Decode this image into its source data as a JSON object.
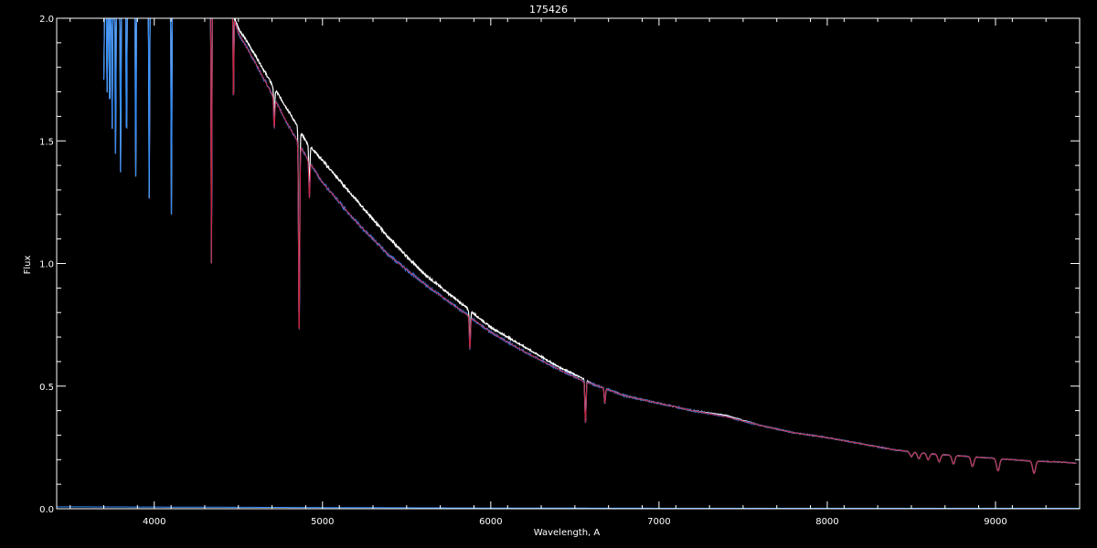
{
  "chart_data": {
    "type": "line",
    "title": "175426",
    "xlabel": "Wavelength, A",
    "ylabel": "Flux",
    "xlim": [
      3420,
      9500
    ],
    "ylim": [
      0.0,
      2.0
    ],
    "x_ticks": [
      4000,
      5000,
      6000,
      7000,
      8000,
      9000
    ],
    "y_ticks": [
      0.0,
      0.5,
      1.0,
      1.5,
      2.0
    ],
    "x_tick_labels": [
      "4000",
      "5000",
      "6000",
      "7000",
      "8000",
      "9000"
    ],
    "y_tick_labels": [
      "0.0",
      "0.5",
      "1.0",
      "1.5",
      "2.0"
    ],
    "grid": false,
    "colors": {
      "background": "#000000",
      "axes": "#ffffff",
      "observed": "#ffffff",
      "flux": "#2f8cff",
      "model": "#d0213a",
      "error": "#2f8cff"
    },
    "series": [
      {
        "key": "observed",
        "x": [
          3700,
          4000,
          4300,
          4450,
          4500,
          4600,
          4700,
          4800,
          4900,
          5000,
          5200,
          5400,
          5600,
          5800,
          6000,
          6200,
          6400,
          6550,
          6600,
          6800,
          7000,
          7200,
          7400,
          7600,
          7800,
          8000,
          8200,
          8400,
          8600,
          8800,
          9000,
          9200,
          9400,
          9480
        ],
        "y": [
          2.05,
          2.05,
          2.05,
          2.05,
          1.96,
          1.85,
          1.73,
          1.62,
          1.5,
          1.42,
          1.26,
          1.1,
          0.96,
          0.85,
          0.74,
          0.66,
          0.58,
          0.53,
          0.51,
          0.46,
          0.43,
          0.4,
          0.38,
          0.34,
          0.31,
          0.29,
          0.265,
          0.24,
          0.225,
          0.215,
          0.205,
          0.195,
          0.19,
          0.185
        ]
      },
      {
        "key": "flux",
        "x": [
          3700,
          4000,
          4300,
          4450,
          4500,
          4600,
          4700,
          4800,
          4900,
          5000,
          5200,
          5400,
          5600,
          5800,
          6000,
          6200,
          6400,
          6550,
          6600,
          6800,
          7000,
          7200,
          7400,
          7600,
          7800,
          8000,
          8200,
          8400,
          8600,
          8800,
          9000,
          9200,
          9400,
          9480
        ],
        "y": [
          2.05,
          2.05,
          2.05,
          2.05,
          1.94,
          1.82,
          1.69,
          1.56,
          1.44,
          1.33,
          1.17,
          1.03,
          0.92,
          0.82,
          0.72,
          0.64,
          0.57,
          0.52,
          0.51,
          0.46,
          0.43,
          0.4,
          0.375,
          0.34,
          0.31,
          0.29,
          0.265,
          0.24,
          0.225,
          0.215,
          0.205,
          0.195,
          0.19,
          0.185
        ]
      },
      {
        "key": "model",
        "x": [
          4300,
          4450,
          4500,
          4600,
          4700,
          4800,
          4900,
          5000,
          5200,
          5400,
          5600,
          5800,
          6000,
          6200,
          6400,
          6550,
          6600,
          6800,
          7000,
          7200,
          7400,
          7600,
          7800,
          8000,
          8200,
          8400,
          8600,
          8800,
          9000,
          9200,
          9400,
          9480
        ],
        "y": [
          2.05,
          2.05,
          1.94,
          1.82,
          1.69,
          1.56,
          1.44,
          1.33,
          1.17,
          1.03,
          0.92,
          0.82,
          0.72,
          0.64,
          0.57,
          0.52,
          0.51,
          0.46,
          0.43,
          0.4,
          0.375,
          0.34,
          0.31,
          0.29,
          0.265,
          0.24,
          0.225,
          0.215,
          0.205,
          0.195,
          0.19,
          0.185
        ]
      },
      {
        "key": "error",
        "x": [
          3420,
          4000,
          5000,
          6000,
          7000,
          8000,
          9000,
          9500
        ],
        "y": [
          0.008,
          0.007,
          0.005,
          0.003,
          0.002,
          0.002,
          0.002,
          0.002
        ]
      }
    ],
    "absorption_lines": [
      {
        "x": 3700,
        "depth": 0.3
      },
      {
        "x": 3720,
        "depth": 0.35
      },
      {
        "x": 3735,
        "depth": 0.42
      },
      {
        "x": 3750,
        "depth": 0.5
      },
      {
        "x": 3770,
        "depth": 0.6
      },
      {
        "x": 3800,
        "depth": 0.68
      },
      {
        "x": 3835,
        "depth": 0.55
      },
      {
        "x": 3890,
        "depth": 0.7
      },
      {
        "x": 3970,
        "depth": 0.78
      },
      {
        "x": 4102,
        "depth": 0.85
      },
      {
        "x": 4340,
        "depth": 1.05
      },
      {
        "x": 4471,
        "depth": 0.35
      },
      {
        "x": 4713,
        "depth": 0.12
      },
      {
        "x": 4861,
        "depth": 0.78
      },
      {
        "x": 4922,
        "depth": 0.15
      },
      {
        "x": 5876,
        "depth": 0.13
      },
      {
        "x": 6563,
        "depth": 0.17
      },
      {
        "x": 6678,
        "depth": 0.06
      },
      {
        "x": 8500,
        "depth": 0.02
      },
      {
        "x": 8545,
        "depth": 0.025
      },
      {
        "x": 8600,
        "depth": 0.025
      },
      {
        "x": 8665,
        "depth": 0.03
      },
      {
        "x": 8750,
        "depth": 0.035
      },
      {
        "x": 8863,
        "depth": 0.04
      },
      {
        "x": 9015,
        "depth": 0.05
      },
      {
        "x": 9229,
        "depth": 0.05
      }
    ]
  }
}
